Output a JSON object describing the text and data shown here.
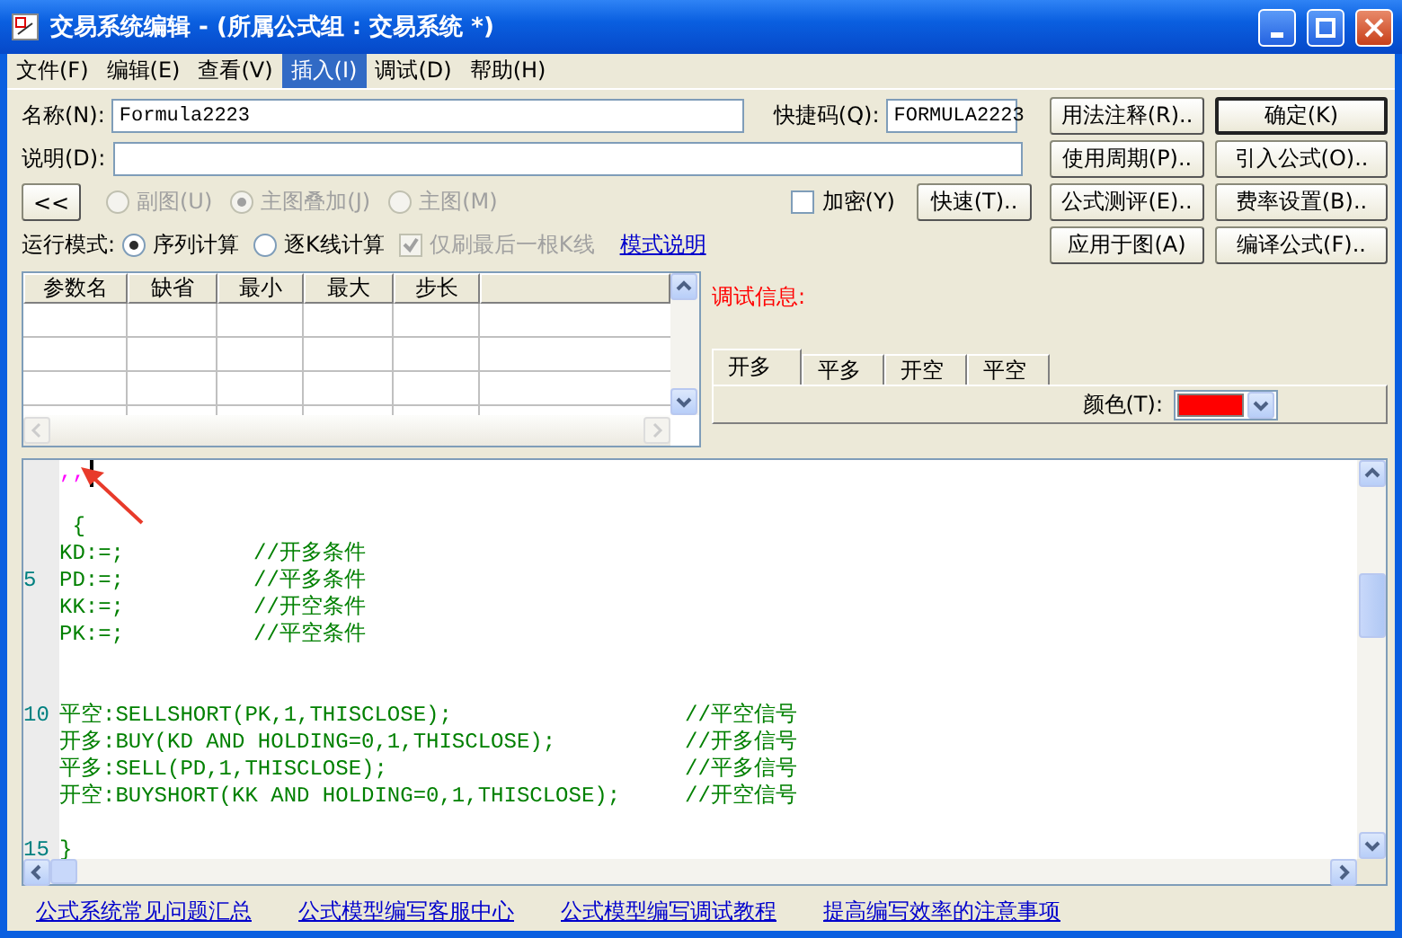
{
  "window": {
    "title": "交易系统编辑 - (所属公式组 : 交易系统 *)"
  },
  "menu": [
    {
      "label": "文件(F)",
      "selected": false
    },
    {
      "label": "编辑(E)",
      "selected": false
    },
    {
      "label": "查看(V)",
      "selected": false
    },
    {
      "label": "插入(I)",
      "selected": true
    },
    {
      "label": "调试(D)",
      "selected": false
    },
    {
      "label": "帮助(H)",
      "selected": false
    }
  ],
  "form": {
    "name": {
      "label": "名称(N):",
      "value": "Formula2223"
    },
    "shortcut": {
      "label": "快捷码(Q):",
      "value": "FORMULA2223"
    },
    "description": {
      "label": "说明(D):"
    }
  },
  "collapse_button": "<<",
  "display_options": [
    {
      "label": "副图(U)",
      "selected": false,
      "disabled": true
    },
    {
      "label": "主图叠加(J)",
      "selected": true,
      "disabled": true
    },
    {
      "label": "主图(M)",
      "selected": false,
      "disabled": true
    }
  ],
  "encrypt": {
    "label": "加密(Y)",
    "checked": false
  },
  "quick_button": "快速(T)..",
  "run_mode": {
    "label": "运行模式:",
    "options": [
      {
        "label": "序列计算",
        "selected": true
      },
      {
        "label": "逐K线计算",
        "selected": false
      }
    ],
    "refresh_last": {
      "label": "仅刷最后一根K线",
      "checked": true,
      "disabled": true
    },
    "link": "模式说明"
  },
  "side_buttons": [
    {
      "label": "用法注释(R)..",
      "default": false
    },
    {
      "label": "确定(K)",
      "default": true
    },
    {
      "label": "使用周期(P)..",
      "default": false
    },
    {
      "label": "引入公式(O)..",
      "default": false
    },
    {
      "label": "公式测评(E)..",
      "default": false
    },
    {
      "label": "费率设置(B)..",
      "default": false
    },
    {
      "label": "应用于图(A)",
      "default": false
    },
    {
      "label": "编译公式(F)..",
      "default": false
    }
  ],
  "params_table": {
    "columns": [
      "参数名",
      "缺省",
      "最小",
      "最大",
      "步长"
    ]
  },
  "debug": {
    "label": "调试信息:"
  },
  "signal_tabs": [
    {
      "label": "开多",
      "selected": true
    },
    {
      "label": "平多",
      "selected": false
    },
    {
      "label": "开空",
      "selected": false
    },
    {
      "label": "平空",
      "selected": false
    }
  ],
  "color_field": {
    "label": "颜色(T):",
    "color": "#ff0000"
  },
  "editor": {
    "lines": [
      {
        "kind": "string",
        "text": ",,"
      },
      {
        "kind": "blank"
      },
      {
        "kind": "code",
        "text": " {"
      },
      {
        "kind": "code",
        "text": "KD:=;          //开多条件"
      },
      {
        "kind": "code",
        "number": "5",
        "text": "PD:=;          //平多条件"
      },
      {
        "kind": "code",
        "text": "KK:=;          //开空条件"
      },
      {
        "kind": "code",
        "text": "PK:=;          //平空条件"
      },
      {
        "kind": "blank"
      },
      {
        "kind": "blank"
      },
      {
        "kind": "code",
        "number": "10",
        "text": "平空:SELLSHORT(PK,1,THISCLOSE);                  //平空信号"
      },
      {
        "kind": "code",
        "text": "开多:BUY(KD AND HOLDING=0,1,THISCLOSE);          //开多信号"
      },
      {
        "kind": "code",
        "text": "平多:SELL(PD,1,THISCLOSE);                       //平多信号"
      },
      {
        "kind": "code",
        "text": "开空:BUYSHORT(KK AND HOLDING=0,1,THISCLOSE);     //开空信号"
      },
      {
        "kind": "blank"
      },
      {
        "kind": "code",
        "number": "15",
        "text": "}"
      }
    ]
  },
  "footer_links": [
    "公式系统常见问题汇总",
    "公式模型编写客服中心",
    "公式模型编写调试教程",
    "提高编写效率的注意事项"
  ]
}
